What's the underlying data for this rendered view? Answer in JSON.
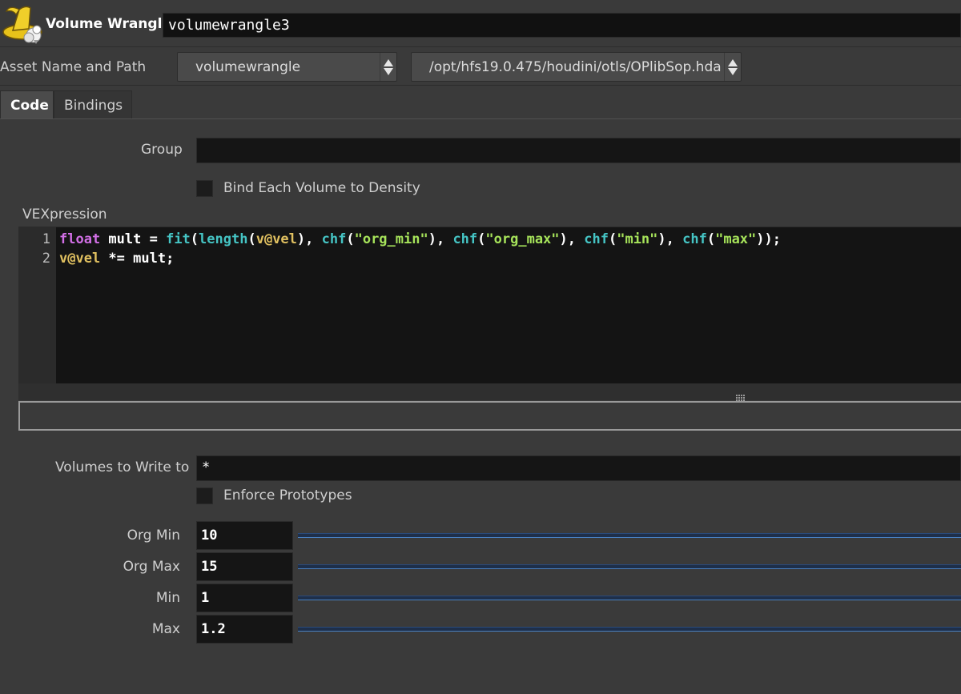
{
  "header": {
    "node_type": "Volume Wrangle",
    "node_name": "volumewrangle3",
    "icon": "wizard-hat-icon"
  },
  "asset": {
    "label": "Asset Name and Path",
    "name": "volumewrangle",
    "path": "/opt/hfs19.0.475/houdini/otls/OPlibSop.hda"
  },
  "tabs": [
    {
      "label": "Code",
      "active": true
    },
    {
      "label": "Bindings",
      "active": false
    }
  ],
  "params": {
    "group_label": "Group",
    "group_value": "",
    "bind_each_label": "Bind Each Volume to Density",
    "bind_each_checked": false,
    "vex_label": "VEXpression",
    "volumes_label": "Volumes to Write to",
    "volumes_value": "*",
    "enforce_label": "Enforce Prototypes",
    "enforce_checked": false,
    "sliders": [
      {
        "label": "Org Min",
        "value": "10"
      },
      {
        "label": "Org Max",
        "value": "15"
      },
      {
        "label": "Min",
        "value": "1"
      },
      {
        "label": "Max",
        "value": "1.2"
      }
    ]
  },
  "code": {
    "line_numbers": [
      "1",
      "2"
    ],
    "lines": [
      "float mult = fit(length(v@vel), chf(\"org_min\"), chf(\"org_max\"), chf(\"min\"), chf(\"max\"));",
      "v@vel *= mult;"
    ]
  },
  "colors": {
    "keyword": "#d26fe6",
    "function": "#45c4c4",
    "attribute": "#e0c060",
    "string": "#a6e35a",
    "slider": "#4a80c0"
  }
}
